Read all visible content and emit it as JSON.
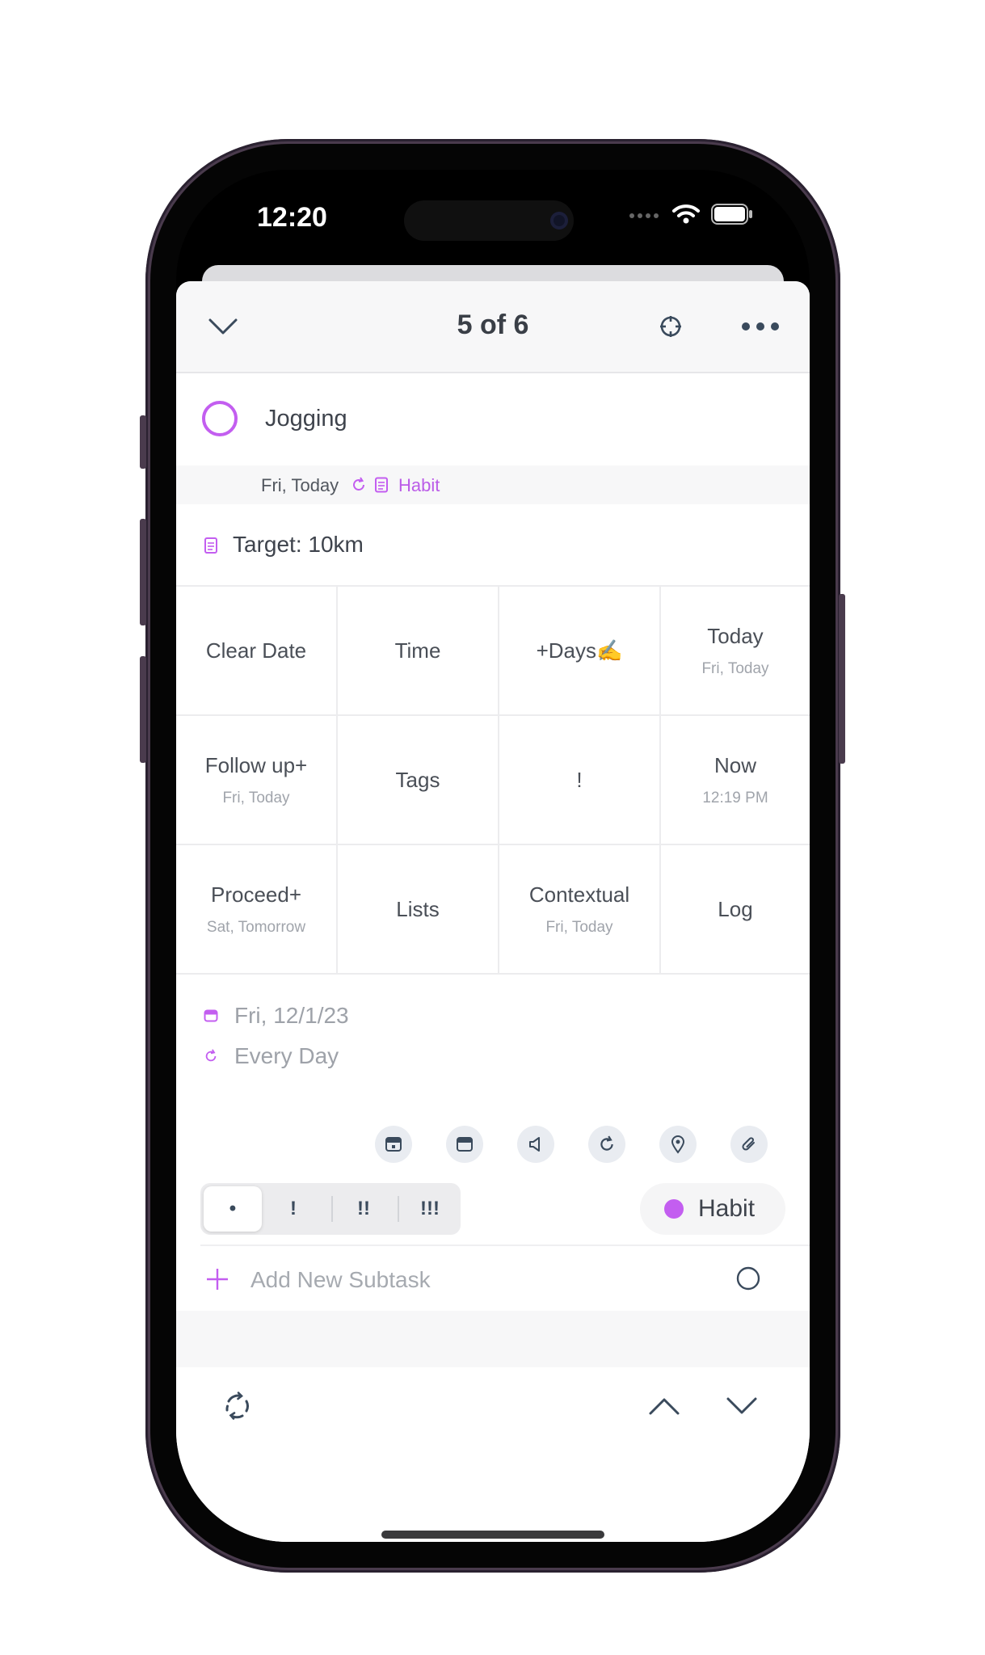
{
  "status_bar": {
    "time": "12:20"
  },
  "header": {
    "counter": "5 of 6",
    "collapse_icon": "chevron-down-icon",
    "focus_icon": "crosshair-icon",
    "more_icon": "more-dots-icon"
  },
  "task": {
    "title": "Jogging",
    "date_label": "Fri, Today",
    "list_name": "Habit",
    "note": "Target: 10km"
  },
  "quick_actions": [
    {
      "label": "Clear Date",
      "sub": ""
    },
    {
      "label": "Time",
      "sub": ""
    },
    {
      "label": "+Days✍️",
      "sub": ""
    },
    {
      "label": "Today",
      "sub": "Fri, Today"
    },
    {
      "label": "Follow up+",
      "sub": "Fri, Today"
    },
    {
      "label": "Tags",
      "sub": ""
    },
    {
      "label": "!",
      "sub": ""
    },
    {
      "label": "Now",
      "sub": "12:19 PM"
    },
    {
      "label": "Proceed+",
      "sub": "Sat, Tomorrow"
    },
    {
      "label": "Lists",
      "sub": ""
    },
    {
      "label": "Contextual",
      "sub": "Fri, Today"
    },
    {
      "label": "Log",
      "sub": ""
    }
  ],
  "schedule": {
    "date": "Fri, 12/1/23",
    "repeat": "Every Day"
  },
  "toolbar_icons": [
    "start-date-icon",
    "due-date-icon",
    "reminder-icon",
    "repeat-icon",
    "location-icon",
    "attachment-icon"
  ],
  "priority": {
    "options": [
      "•",
      "!",
      "!!",
      "!!!"
    ],
    "selected": "•"
  },
  "list_chip": {
    "label": "Habit",
    "color": "#c35ef0"
  },
  "subtask": {
    "placeholder": "Add New Subtask"
  },
  "colors": {
    "accent": "#c35ef0",
    "icon_dark": "#3a4a5c"
  }
}
